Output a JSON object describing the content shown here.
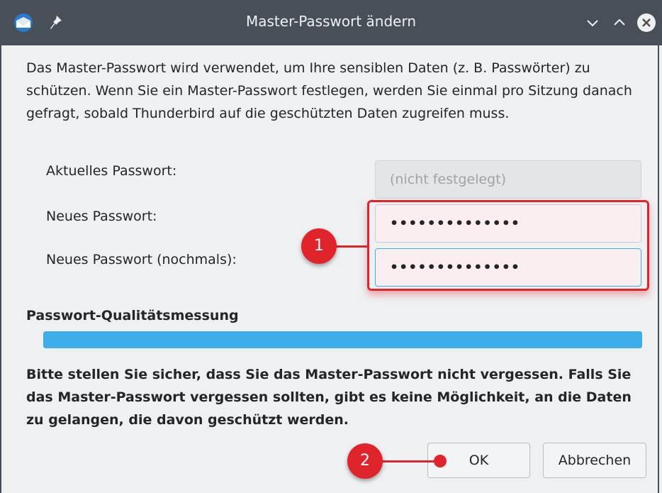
{
  "window": {
    "title": "Master-Passwort ändern",
    "icons": [
      "thunderbird-icon",
      "pin-icon",
      "minimize-icon",
      "maximize-icon",
      "close-icon"
    ]
  },
  "description": "Das Master-Passwort wird verwendet, um Ihre sensiblen Daten (z. B. Passwörter) zu schützen. Wenn Sie ein Master-Passwort festlegen, werden Sie einmal pro Sitzung danach gefragt, sobald Thunderbird auf die geschützten Daten zugreifen muss.",
  "fields": {
    "current_label": "Aktuelles Passwort:",
    "current_placeholder": "(nicht festgelegt)",
    "new_label": "Neues Passwort:",
    "new_value": "••••••••••••••",
    "confirm_label": "Neues Passwort (nochmals):",
    "confirm_value": "••••••••••••••"
  },
  "quality": {
    "heading": "Passwort-Qualitätsmessung",
    "level_percent": 100
  },
  "warning": "Bitte stellen Sie sicher, dass Sie das Master-Passwort nicht vergessen. Falls Sie das Master-Passwort vergessen sollten, gibt es keine Möglichkeit, an die Daten zu gelangen, die davon geschützt werden.",
  "buttons": {
    "ok": "OK",
    "cancel": "Abbrechen"
  },
  "callouts": {
    "first": "1",
    "second": "2"
  },
  "colors": {
    "titlebar": "#475057",
    "accent": "#3daee9",
    "callout": "#e0242c"
  }
}
